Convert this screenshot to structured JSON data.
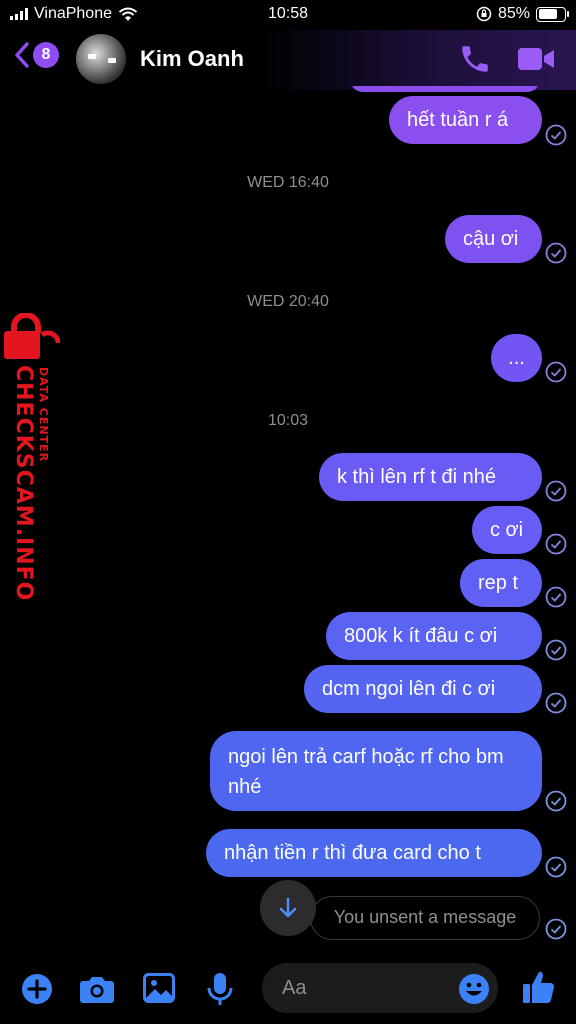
{
  "status": {
    "carrier": "VinaPhone",
    "time": "10:58",
    "battery_percent": "85%",
    "battery_level": 0.85
  },
  "header": {
    "back_badge": "8",
    "contact_name": "Kim Oanh"
  },
  "colors": {
    "purple_bubble": "#8a4fee",
    "violet_bubble": "#6a5bf5",
    "blue_bubble": "#4f67f0",
    "accent": "#8f4cf2",
    "blue_icon": "#3b82f6"
  },
  "messages": {
    "m1": "hết tuần r á",
    "ts1": "WED 16:40",
    "m2": "cậu ơi",
    "ts2": "WED 20:40",
    "m3": "...",
    "ts3": "10:03",
    "m4": "k thì lên rf t đi nhé",
    "m5": "c ơi",
    "m6": "rep t",
    "m7": "800k k ít đâu c ơi",
    "m8": "dcm ngoi lên đi c ơi",
    "m9": "ngoi lên trả carf hoặc rf cho bm nhé",
    "m10": "nhận tiền r thì đưa card cho t",
    "unsent": "You unsent a message"
  },
  "watermark": {
    "main": "CHECKSCAM.INFO",
    "sub": "DATA CENTER"
  },
  "composer": {
    "placeholder": "Aa"
  }
}
